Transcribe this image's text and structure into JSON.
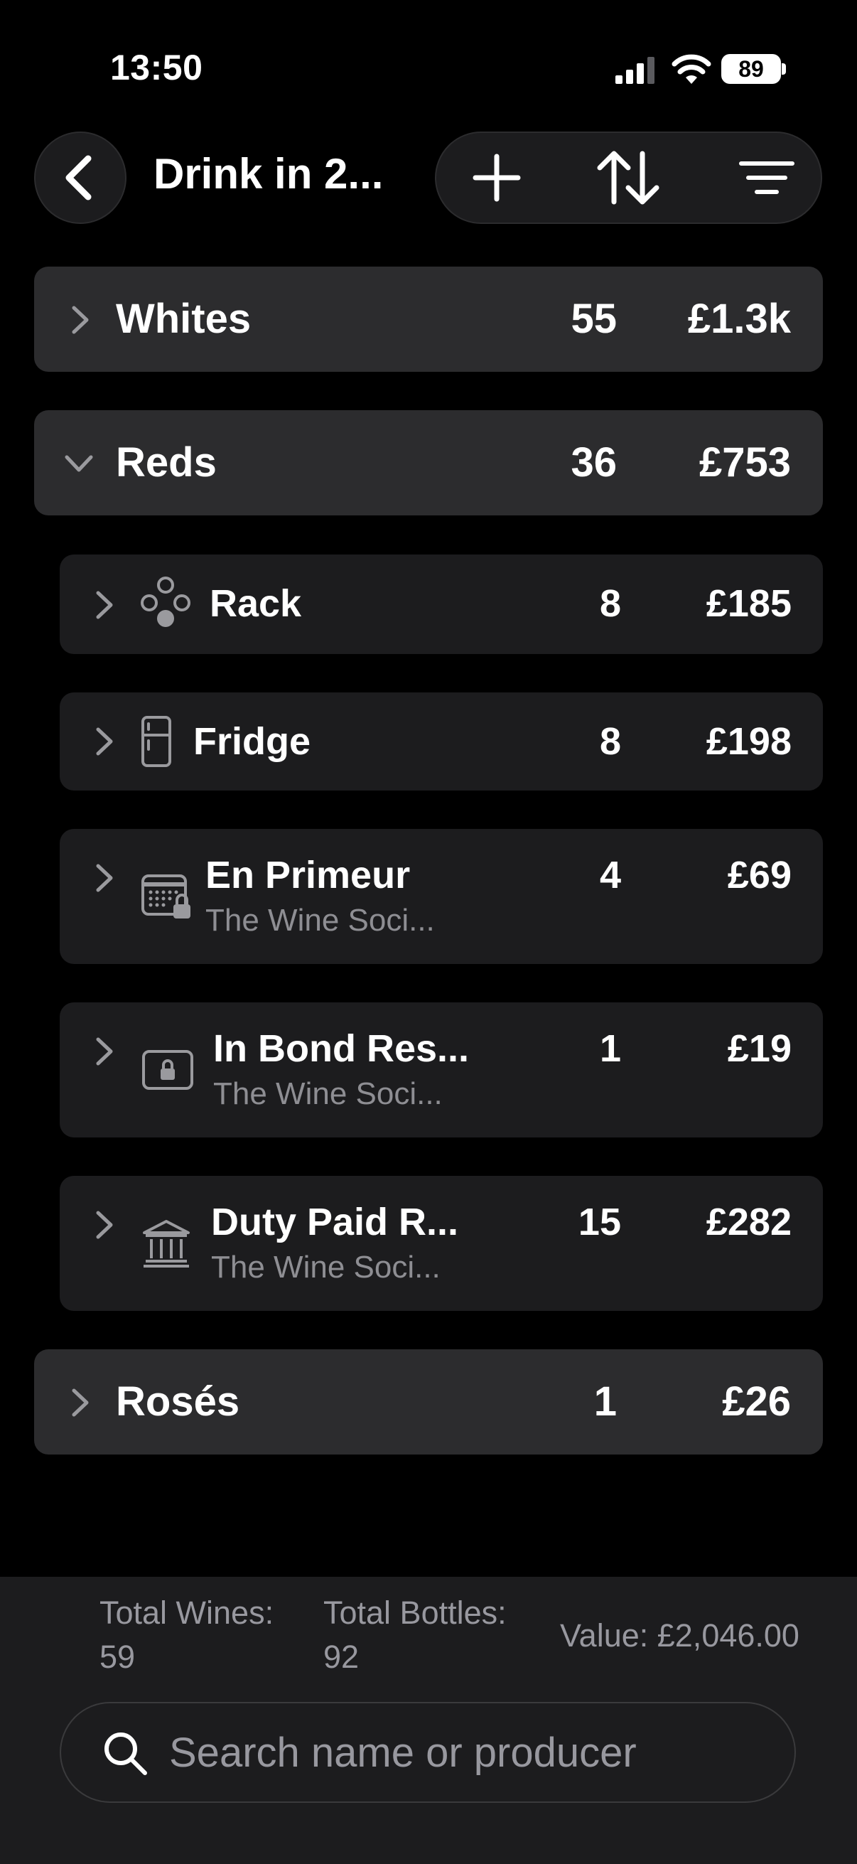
{
  "status": {
    "time": "13:50",
    "battery": "89"
  },
  "nav": {
    "title": "Drink in 2..."
  },
  "groups": {
    "whites": {
      "label": "Whites",
      "count": "55",
      "value": "£1.3k"
    },
    "reds": {
      "label": "Reds",
      "count": "36",
      "value": "£753"
    },
    "roses": {
      "label": "Rosés",
      "count": "1",
      "value": "£26"
    }
  },
  "locations": [
    {
      "label": "Rack",
      "sub": "",
      "count": "8",
      "value": "£185",
      "icon": "rack-icon"
    },
    {
      "label": "Fridge",
      "sub": "",
      "count": "8",
      "value": "£198",
      "icon": "fridge-icon"
    },
    {
      "label": "En Primeur",
      "sub": "The Wine Soci...",
      "count": "4",
      "value": "£69",
      "icon": "calendar-lock-icon"
    },
    {
      "label": "In Bond Res...",
      "sub": "The Wine Soci...",
      "count": "1",
      "value": "£19",
      "icon": "lock-box-icon"
    },
    {
      "label": "Duty Paid R...",
      "sub": "The Wine Soci...",
      "count": "15",
      "value": "£282",
      "icon": "bank-icon"
    }
  ],
  "footer": {
    "total_wines_label": "Total Wines:",
    "total_wines": "59",
    "total_bottles_label": "Total Bottles:",
    "total_bottles": "92",
    "value": "Value: £2,046.00"
  },
  "search": {
    "placeholder": "Search name or producer"
  }
}
